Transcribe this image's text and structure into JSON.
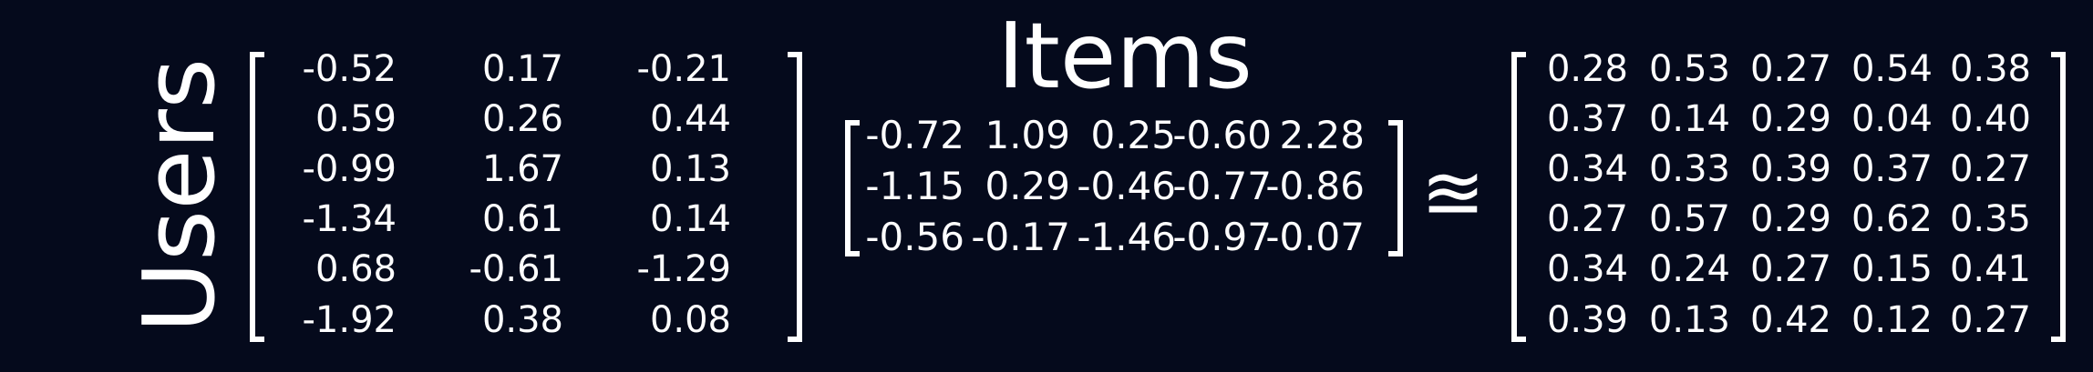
{
  "labels": {
    "users": "Users",
    "items": "Items",
    "approx": "≊"
  },
  "user_matrix": [
    [
      "-0.52",
      "0.17",
      "-0.21"
    ],
    [
      "0.59",
      "0.26",
      "0.44"
    ],
    [
      "-0.99",
      "1.67",
      "0.13"
    ],
    [
      "-1.34",
      "0.61",
      "0.14"
    ],
    [
      "0.68",
      "-0.61",
      "-1.29"
    ],
    [
      "-1.92",
      "0.38",
      "0.08"
    ]
  ],
  "item_matrix": [
    [
      "-0.72",
      "1.09",
      "0.25",
      "-0.60",
      "2.28"
    ],
    [
      "-1.15",
      "0.29",
      "-0.46",
      "-0.77",
      "-0.86"
    ],
    [
      "-0.56",
      "-0.17",
      "-1.46",
      "-0.97",
      "-0.07"
    ]
  ],
  "result_matrix": [
    [
      "0.28",
      "0.53",
      "0.27",
      "0.54",
      "0.38"
    ],
    [
      "0.37",
      "0.14",
      "0.29",
      "0.04",
      "0.40"
    ],
    [
      "0.34",
      "0.33",
      "0.39",
      "0.37",
      "0.27"
    ],
    [
      "0.27",
      "0.57",
      "0.29",
      "0.62",
      "0.35"
    ],
    [
      "0.34",
      "0.24",
      "0.27",
      "0.15",
      "0.41"
    ],
    [
      "0.39",
      "0.13",
      "0.42",
      "0.12",
      "0.27"
    ]
  ]
}
